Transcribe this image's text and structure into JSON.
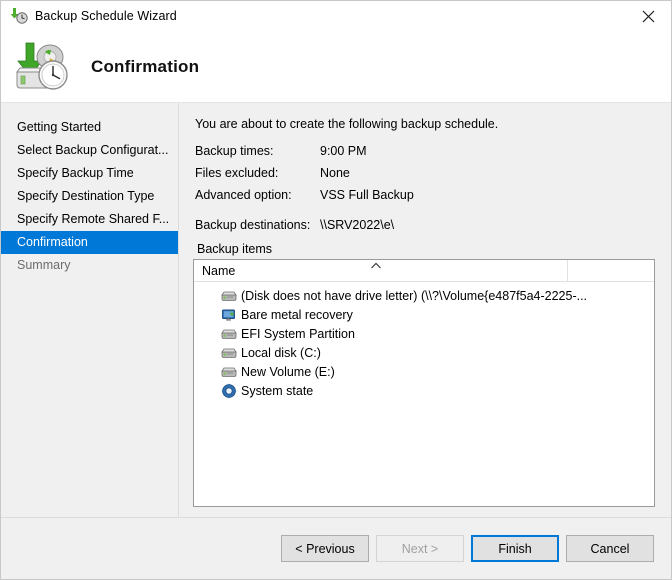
{
  "window": {
    "title": "Backup Schedule Wizard",
    "title_icon": "backup-schedule-icon",
    "close_icon": "close-icon"
  },
  "header": {
    "title": "Confirmation",
    "icon": "backup-disk-clock-icon"
  },
  "sidebar": {
    "items": [
      {
        "label": "Getting Started",
        "state": "normal"
      },
      {
        "label": "Select Backup Configurat...",
        "state": "normal"
      },
      {
        "label": "Specify Backup Time",
        "state": "normal"
      },
      {
        "label": "Specify Destination Type",
        "state": "normal"
      },
      {
        "label": "Specify Remote Shared F...",
        "state": "normal"
      },
      {
        "label": "Confirmation",
        "state": "selected"
      },
      {
        "label": "Summary",
        "state": "disabled"
      }
    ],
    "selected_color": "#0078d7"
  },
  "content": {
    "intro": "You are about to create the following backup schedule.",
    "summary": [
      {
        "label": "Backup times:",
        "value": "9:00 PM"
      },
      {
        "label": "Files excluded:",
        "value": "None"
      },
      {
        "label": "Advanced option:",
        "value": "VSS Full Backup"
      },
      {
        "label": "Backup destinations:",
        "value": "\\\\SRV2022\\e\\"
      }
    ],
    "items_label": "Backup items",
    "list": {
      "column_header": "Name",
      "sort_icon": "sort-ascending-icon",
      "rows": [
        {
          "label": "(Disk does not have drive letter) (\\\\?\\Volume{e487f5a4-2225-...",
          "icon": "disk-drive-icon"
        },
        {
          "label": "Bare metal recovery",
          "icon": "bare-metal-recovery-icon"
        },
        {
          "label": "EFI System Partition",
          "icon": "disk-drive-icon"
        },
        {
          "label": "Local disk (C:)",
          "icon": "disk-drive-icon"
        },
        {
          "label": "New Volume (E:)",
          "icon": "disk-drive-icon"
        },
        {
          "label": "System state",
          "icon": "system-state-icon"
        }
      ]
    }
  },
  "footer": {
    "previous": "< Previous",
    "next": "Next >",
    "finish": "Finish",
    "cancel": "Cancel"
  }
}
